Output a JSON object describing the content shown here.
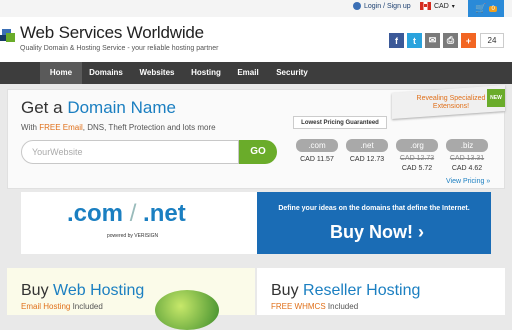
{
  "topbar": {
    "login_label": "Login / Sign up",
    "currency": "CAD",
    "cart_count": "0"
  },
  "header": {
    "title": "Web Services Worldwide",
    "subtitle": "Quality Domain & Hosting Service - your reliable hosting partner",
    "share_count": "24"
  },
  "nav": [
    "Home",
    "Domains",
    "Websites",
    "Hosting",
    "Email",
    "Security"
  ],
  "domain": {
    "title_pre": "Get a ",
    "title_hl": "Domain Name",
    "sub_pre": "With ",
    "sub_hl": "FREE Email",
    "sub_post": ", DNS, Theft Protection and lots more",
    "search_placeholder": "YourWebsite",
    "go_label": "GO",
    "pricing_label": "Lowest Pricing Guaranteed",
    "special_label": "Revealing Specialized Extensions!",
    "new_label": "NEW",
    "view_pricing": "View Pricing »",
    "tlds": [
      {
        "name": ".com",
        "old": "",
        "price": "CAD 11.57"
      },
      {
        "name": ".net",
        "old": "",
        "price": "CAD 12.73"
      },
      {
        "name": ".org",
        "old": "CAD 12.73",
        "price": "CAD 5.72"
      },
      {
        "name": ".biz",
        "old": "CAD 13.31",
        "price": "CAD 4.62"
      }
    ]
  },
  "promo": {
    "com": ".com",
    "net": ".net",
    "powered": "powered by VERISIGN",
    "define": "Define your ideas on the domains that define the Internet.",
    "buy_now": "Buy Now!"
  },
  "hosting": {
    "left_pre": "Buy ",
    "left_hl": "Web Hosting",
    "left_sub_hl": "Email Hosting",
    "left_sub_post": " Included",
    "right_pre": "Buy ",
    "right_hl": "Reseller Hosting",
    "right_sub_hl": "FREE WHMCS",
    "right_sub_post": " Included"
  },
  "colors": {
    "brand_blue": "#1b7fc1",
    "accent_orange": "#e0701a",
    "go_green": "#6aac2a",
    "nav_bg": "#3d3d3d"
  }
}
